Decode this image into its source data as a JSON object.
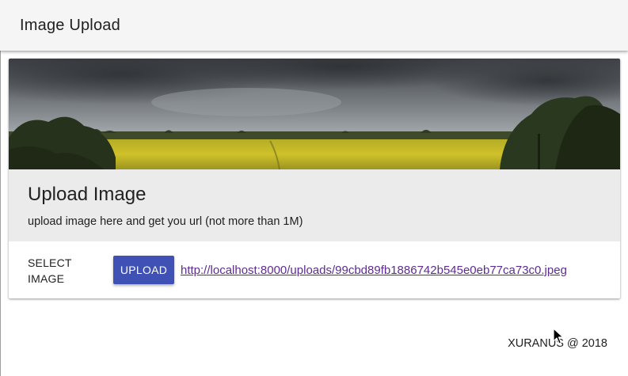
{
  "app_bar": {
    "title": "Image Upload"
  },
  "card": {
    "banner_image": "panoramic-field-landscape",
    "title": "Upload Image",
    "subtitle": "upload image here and get you url (not more than 1M)",
    "select_label": "SELECT IMAGE",
    "upload_button": "UPLOAD",
    "uploaded_url": "http://localhost:8000/uploads/99cbd89fb1886742b545e0eb77ca73c0.jpeg"
  },
  "footer": {
    "text": "XURANUS @ 2018"
  },
  "colors": {
    "app_bar": "#f5f5f5",
    "card_header": "#ebebeb",
    "primary_button": "#3f51b5",
    "link": "#5e2c8f"
  }
}
